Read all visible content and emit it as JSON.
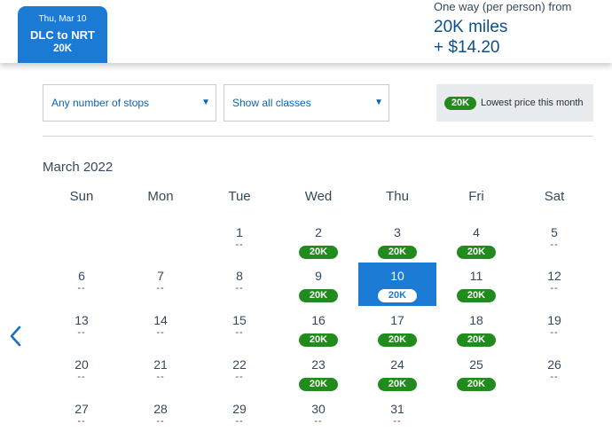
{
  "selected_tab": {
    "date": "Thu, Mar 10",
    "route": "DLC to NRT",
    "price": "20K"
  },
  "fare": {
    "label": "One way (per person) from",
    "miles": "20K miles",
    "fee": "+ $14.20"
  },
  "filters": {
    "stops": "Any number of stops",
    "classes": "Show all classes"
  },
  "legend": {
    "pill": "20K",
    "text": "Lowest price this month"
  },
  "calendar": {
    "month": "March 2022",
    "weekdays": [
      "Sun",
      "Mon",
      "Tue",
      "Wed",
      "Thu",
      "Fri",
      "Sat"
    ],
    "no_price": "--",
    "weeks": [
      [
        null,
        null,
        {
          "day": "1",
          "price": "--"
        },
        {
          "day": "2",
          "price": "20K"
        },
        {
          "day": "3",
          "price": "20K"
        },
        {
          "day": "4",
          "price": "20K"
        },
        {
          "day": "5",
          "price": "--"
        }
      ],
      [
        {
          "day": "6",
          "price": "--"
        },
        {
          "day": "7",
          "price": "--"
        },
        {
          "day": "8",
          "price": "--"
        },
        {
          "day": "9",
          "price": "20K"
        },
        {
          "day": "10",
          "price": "20K",
          "selected": true
        },
        {
          "day": "11",
          "price": "20K"
        },
        {
          "day": "12",
          "price": "--"
        }
      ],
      [
        {
          "day": "13",
          "price": "--"
        },
        {
          "day": "14",
          "price": "--"
        },
        {
          "day": "15",
          "price": "--"
        },
        {
          "day": "16",
          "price": "20K"
        },
        {
          "day": "17",
          "price": "20K"
        },
        {
          "day": "18",
          "price": "20K"
        },
        {
          "day": "19",
          "price": "--"
        }
      ],
      [
        {
          "day": "20",
          "price": "--"
        },
        {
          "day": "21",
          "price": "--"
        },
        {
          "day": "22",
          "price": "--"
        },
        {
          "day": "23",
          "price": "20K"
        },
        {
          "day": "24",
          "price": "20K"
        },
        {
          "day": "25",
          "price": "20K"
        },
        {
          "day": "26",
          "price": "--"
        }
      ],
      [
        {
          "day": "27",
          "price": "--"
        },
        {
          "day": "28",
          "price": "--"
        },
        {
          "day": "29",
          "price": "--"
        },
        {
          "day": "30",
          "price": "--"
        },
        {
          "day": "31",
          "price": "--"
        },
        null,
        null
      ]
    ]
  },
  "colors": {
    "brand_blue": "#1b7bd4",
    "price_green": "#228b1d",
    "link_blue": "#0b62b6"
  },
  "icons": {
    "prev": "chevron-left-icon",
    "dropdown": "caret-down-icon"
  }
}
